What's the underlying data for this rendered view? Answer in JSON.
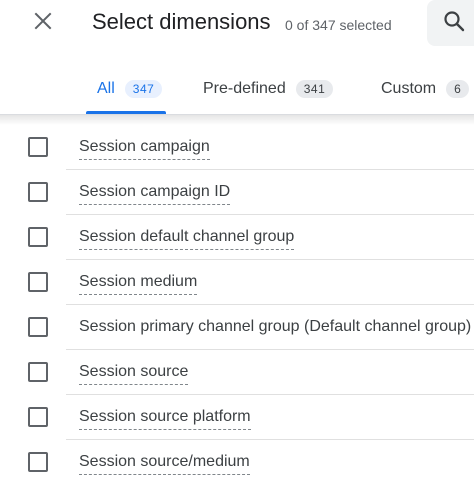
{
  "header": {
    "title": "Select dimensions",
    "selected_count": "0 of 347 selected"
  },
  "icons": {
    "close": "close-icon",
    "search": "search-icon"
  },
  "tabs": [
    {
      "label": "All",
      "count": "347",
      "active": true
    },
    {
      "label": "Pre-defined",
      "count": "341",
      "active": false
    },
    {
      "label": "Custom",
      "count": "6",
      "active": false
    }
  ],
  "dimensions": [
    {
      "label": "Session campaign",
      "checked": false
    },
    {
      "label": "Session campaign ID",
      "checked": false
    },
    {
      "label": "Session default channel group",
      "checked": false
    },
    {
      "label": "Session medium",
      "checked": false
    },
    {
      "label": "Session primary channel group (Default channel group)",
      "checked": false
    },
    {
      "label": "Session source",
      "checked": false
    },
    {
      "label": "Session source platform",
      "checked": false
    },
    {
      "label": "Session source/medium",
      "checked": false
    }
  ],
  "colors": {
    "accent": "#1a73e8",
    "accent_bg": "#e8f0fe",
    "text": "#202124",
    "muted": "#5f6368"
  }
}
